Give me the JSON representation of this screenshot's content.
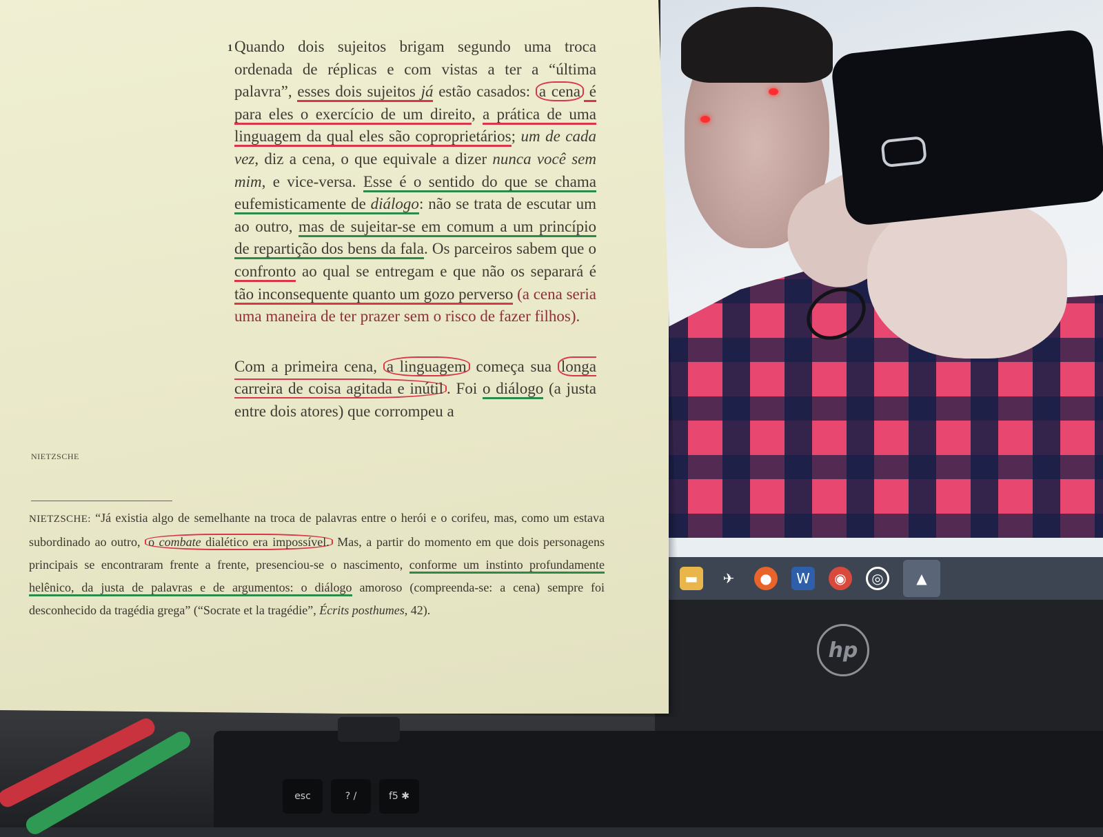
{
  "page": {
    "footnote_marker": "1",
    "paragraph_1": {
      "a": "Quando dois sujeitos brigam segundo uma troca ordenada de réplicas e com vistas a ter a “última palavra”, ",
      "b": "esses dois sujeitos ",
      "c": "já",
      "d": " estão casados: ",
      "e": "a cena",
      "f": " é para eles o exercício de um direito",
      "g": ", ",
      "h": "a prática de uma linguagem da qual eles são coproprietários",
      "i": "; ",
      "j": "um de cada vez",
      "k": ", diz a cena, o que equivale a dizer ",
      "l": "nunca você sem mim",
      "m": ", e vice-versa. ",
      "n": "Esse é o sentido do que se chama eufemisticamente de ",
      "o": "diálogo",
      "p": ": não se trata de escutar um ao outro, ",
      "q": "mas de sujeitar-se em comum a um princípio de repartição dos bens da fala",
      "r": ". Os parceiros sabem que o ",
      "s": "confronto",
      "t": " ao qual se entregam e que não os separará é ",
      "u": "tão inconsequente quanto um gozo perverso",
      "v": " (a cena seria uma maneira de ter prazer sem o risco de fazer filhos)."
    },
    "paragraph_2": {
      "a": "Com a primeira cena, ",
      "b": "a linguagem",
      "c": " começa sua ",
      "d": "longa carreira de coisa agitada e inútil",
      "e": ". Foi ",
      "f": "o diálogo",
      "g": " (a justa entre dois atores) que corrompeu a"
    },
    "side_label": "NIETZSCHE",
    "footnote": {
      "lead": "NIETZSCHE:",
      "a": " “Já existia algo de semelhante na troca de palavras entre o herói e o corifeu, mas, como um estava subordinado ao outro, ",
      "b": "o ",
      "c": "combate",
      "d": " dialético era impossível.",
      "e": " Mas, a partir do momento em que dois personagens principais se encontraram frente a frente, presenciou-se o nascimento, ",
      "f": "conforme um instinto profundamente helênico, da justa de palavras e de argumentos: o diálogo",
      "g": " amoroso (compreenda-se: a cena) sempre foi desconhecido da tragédia grega” (“Socrate et la tragédie”, ",
      "h": "Écrits posthumes",
      "i": ", 42)."
    }
  },
  "laptop": {
    "brand": "hp",
    "taskbar_icons": [
      "folder-icon",
      "bird-icon",
      "firefox-icon",
      "word-icon",
      "chrome-icon",
      "media-icon",
      "photos-icon"
    ],
    "keys": {
      "esc": "esc",
      "question": "? /",
      "f5": "f5 ✱"
    }
  },
  "colors": {
    "red_ink": "#d9364a",
    "green_ink": "#2b8a4a",
    "paper": "#eeedd0"
  }
}
